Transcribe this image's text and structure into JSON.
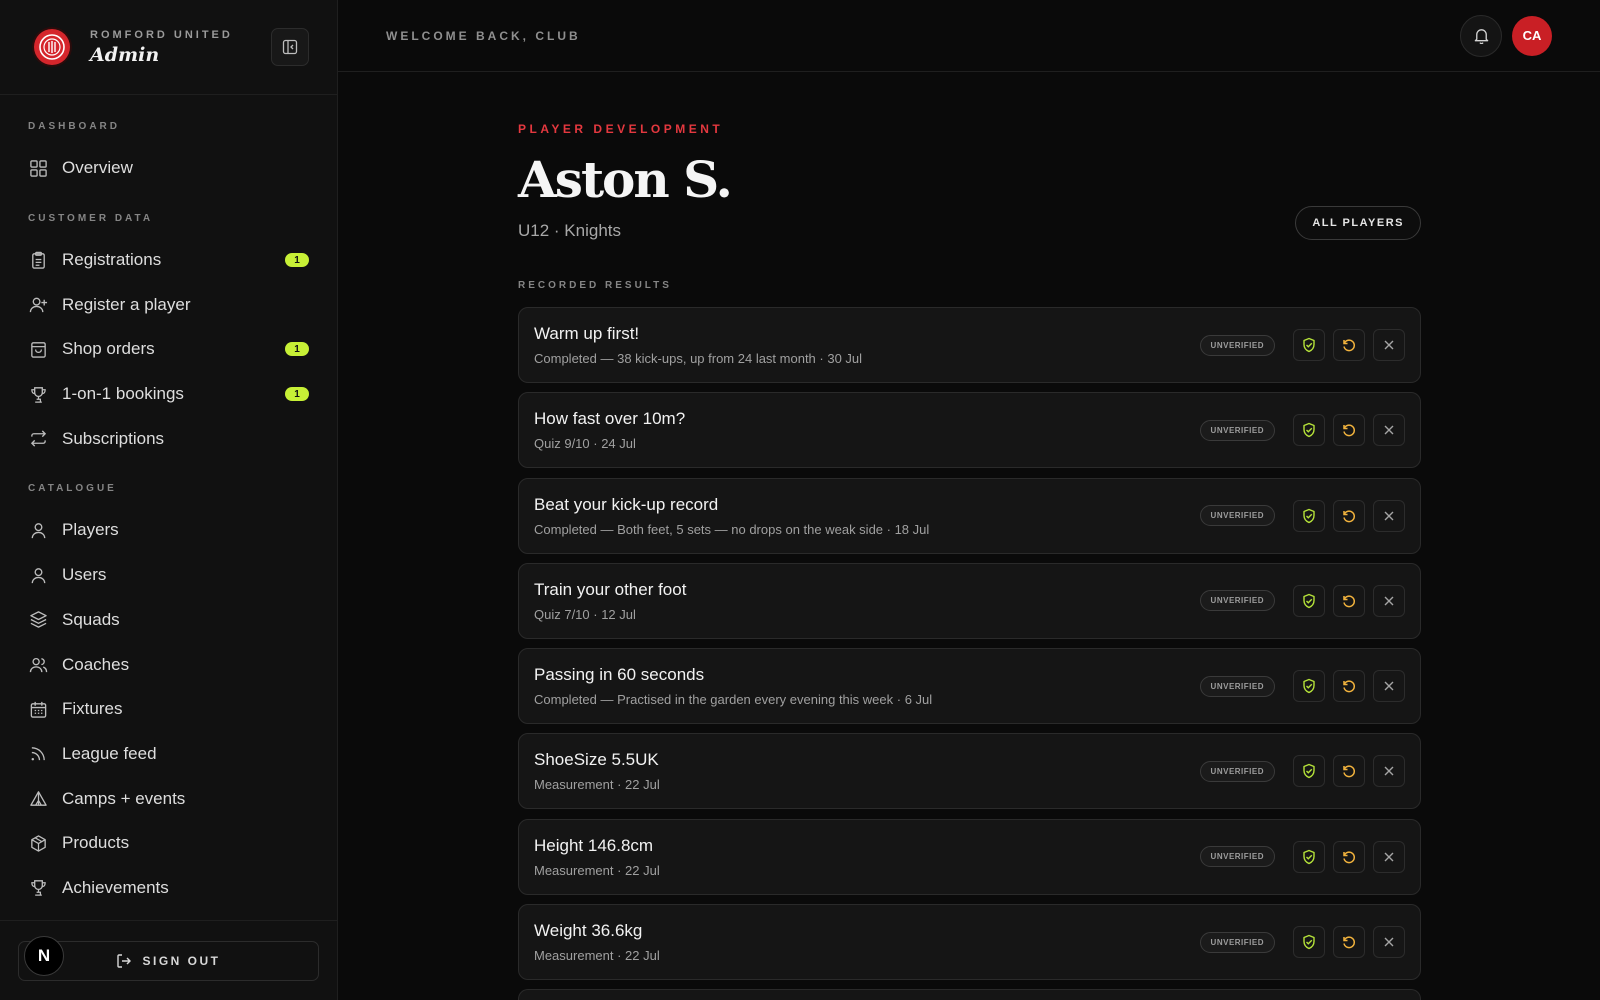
{
  "brand": {
    "club": "ROMFORD UNITED",
    "role": "Admin"
  },
  "sidebar": {
    "sections": [
      {
        "label": "DASHBOARD",
        "items": [
          {
            "label": "Overview",
            "icon": "grid-icon"
          }
        ]
      },
      {
        "label": "CUSTOMER DATA",
        "items": [
          {
            "label": "Registrations",
            "icon": "clipboard-icon",
            "badge": "1"
          },
          {
            "label": "Register a player",
            "icon": "user-plus-icon"
          },
          {
            "label": "Shop orders",
            "icon": "shopping-bag-icon",
            "badge": "1"
          },
          {
            "label": "1-on-1 bookings",
            "icon": "trophy-icon",
            "badge": "1"
          },
          {
            "label": "Subscriptions",
            "icon": "repeat-icon"
          }
        ]
      },
      {
        "label": "CATALOGUE",
        "items": [
          {
            "label": "Players",
            "icon": "user-icon"
          },
          {
            "label": "Users",
            "icon": "user-icon"
          },
          {
            "label": "Squads",
            "icon": "layers-icon"
          },
          {
            "label": "Coaches",
            "icon": "users-icon"
          },
          {
            "label": "Fixtures",
            "icon": "calendar-icon"
          },
          {
            "label": "League feed",
            "icon": "rss-icon"
          },
          {
            "label": "Camps + events",
            "icon": "tent-icon"
          },
          {
            "label": "Products",
            "icon": "package-icon"
          },
          {
            "label": "Achievements",
            "icon": "trophy-icon"
          }
        ]
      }
    ],
    "signout_label": "SIGN OUT",
    "n_avatar": "N"
  },
  "topbar": {
    "welcome": "WELCOME BACK, CLUB",
    "avatar_initials": "CA"
  },
  "page": {
    "eyebrow": "PLAYER DEVELOPMENT",
    "player_name": "Aston S.",
    "player_squad": "U12 · Knights",
    "all_players_label": "ALL PLAYERS",
    "section_label": "RECORDED RESULTS"
  },
  "results": [
    {
      "title": "Warm up first!",
      "meta": "Completed — 38 kick-ups, up from 24 last month · 30 Jul",
      "status": "UNVERIFIED"
    },
    {
      "title": "How fast over 10m?",
      "meta": "Quiz 9/10 · 24 Jul",
      "status": "UNVERIFIED"
    },
    {
      "title": "Beat your kick-up record",
      "meta": "Completed — Both feet, 5 sets — no drops on the weak side · 18 Jul",
      "status": "UNVERIFIED"
    },
    {
      "title": "Train your other foot",
      "meta": "Quiz 7/10 · 12 Jul",
      "status": "UNVERIFIED"
    },
    {
      "title": "Passing in 60 seconds",
      "meta": "Completed — Practised in the garden every evening this week · 6 Jul",
      "status": "UNVERIFIED"
    },
    {
      "title": "ShoeSize 5.5UK",
      "meta": "Measurement · 22 Jul",
      "status": "UNVERIFIED"
    },
    {
      "title": "Height 146.8cm",
      "meta": "Measurement · 22 Jul",
      "status": "UNVERIFIED"
    },
    {
      "title": "Weight 36.6kg",
      "meta": "Measurement · 22 Jul",
      "status": "UNVERIFIED"
    }
  ],
  "colors": {
    "accent_red": "#e4383f",
    "badge_green": "#c7f036",
    "verify_green": "#b6e33a",
    "reset_amber": "#f2b33d"
  }
}
